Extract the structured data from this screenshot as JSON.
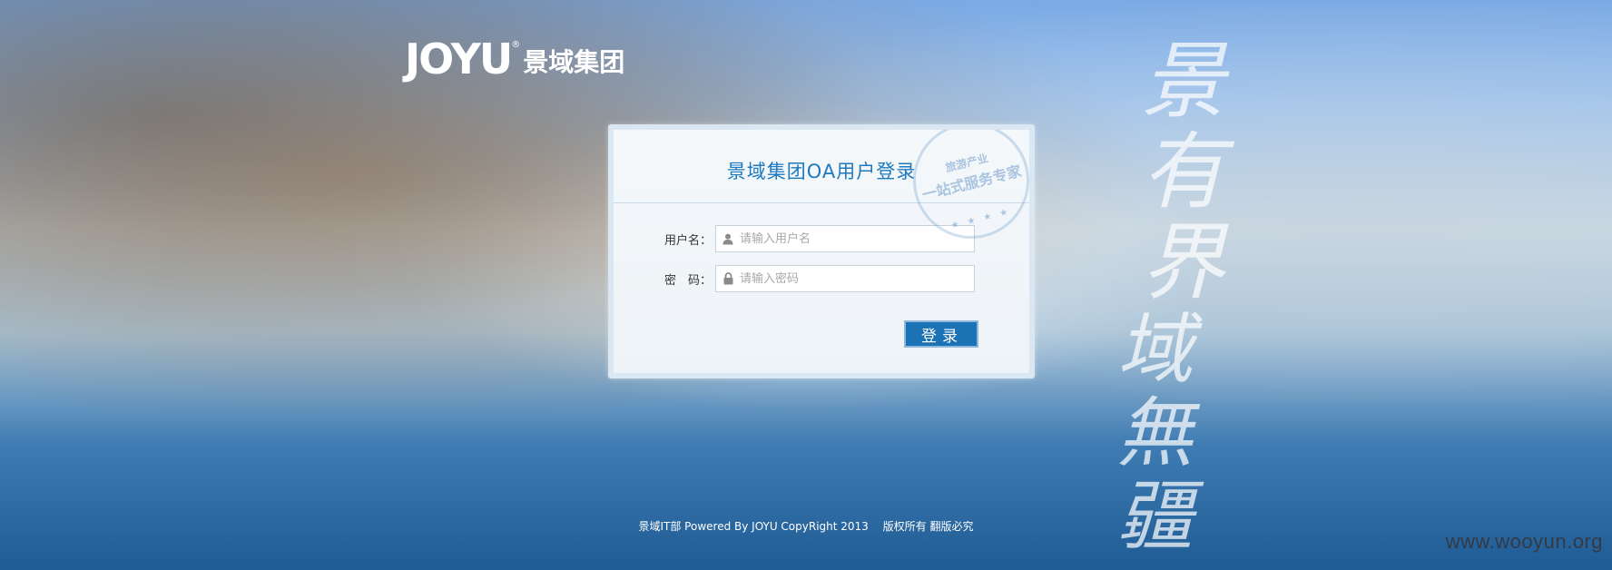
{
  "logo": {
    "mark": "JOYU",
    "registered": "®",
    "company": "景域集团"
  },
  "calligraphy": {
    "line1": "景有界",
    "line2": "域無疆"
  },
  "login": {
    "title": "景域集团OA用户登录",
    "stamp": {
      "top": "旅游产业",
      "main": "一站式服务专家",
      "stars": "★ ★ ★ ★"
    },
    "username": {
      "label": "用户名：",
      "placeholder": "请输入用户名",
      "value": ""
    },
    "password": {
      "label": "密　码：",
      "placeholder": "请输入密码",
      "value": ""
    },
    "submit_label": "登录"
  },
  "footer": {
    "text": "景域IT部 Powered By JOYU CopyRight 2013",
    "rights": "版权所有 翻版必究"
  },
  "watermark": "www.wooyun.org",
  "colors": {
    "accent": "#1b72b5",
    "title": "#1e79bd"
  }
}
